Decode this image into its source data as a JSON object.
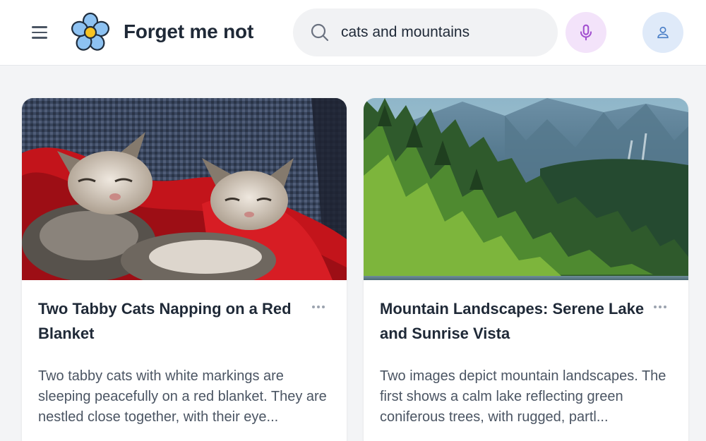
{
  "app": {
    "title": "Forget me not",
    "logo_icon": "forget-me-not-flower-icon"
  },
  "header": {
    "menu_icon": "hamburger-menu-icon",
    "search": {
      "value": "cats and mountains",
      "icon": "search-icon"
    },
    "mic_icon": "microphone-icon",
    "avatar_icon": "user-icon"
  },
  "colors": {
    "mic_bg": "#f3e3fa",
    "mic_icon": "#a24fd0",
    "avatar_bg": "#dfeaf9",
    "avatar_icon": "#4a7fc7",
    "page_bg": "#f3f4f6"
  },
  "cards": [
    {
      "image": "two tabby cats sleeping on red blanket",
      "title": "Two Tabby Cats Napping on a Red Blanket",
      "description": "Two tabby cats with white markings are sleeping peacefully on a red blanket. They are nestled close together, with their eye...",
      "more_icon": "more-horizontal-icon"
    },
    {
      "image": "mountain landscape with forest and lake",
      "title": "Mountain Landscapes: Serene Lake and Sunrise Vista",
      "description": "Two images depict mountain landscapes. The first shows a calm lake reflecting green coniferous trees, with rugged, partl...",
      "more_icon": "more-horizontal-icon"
    }
  ]
}
